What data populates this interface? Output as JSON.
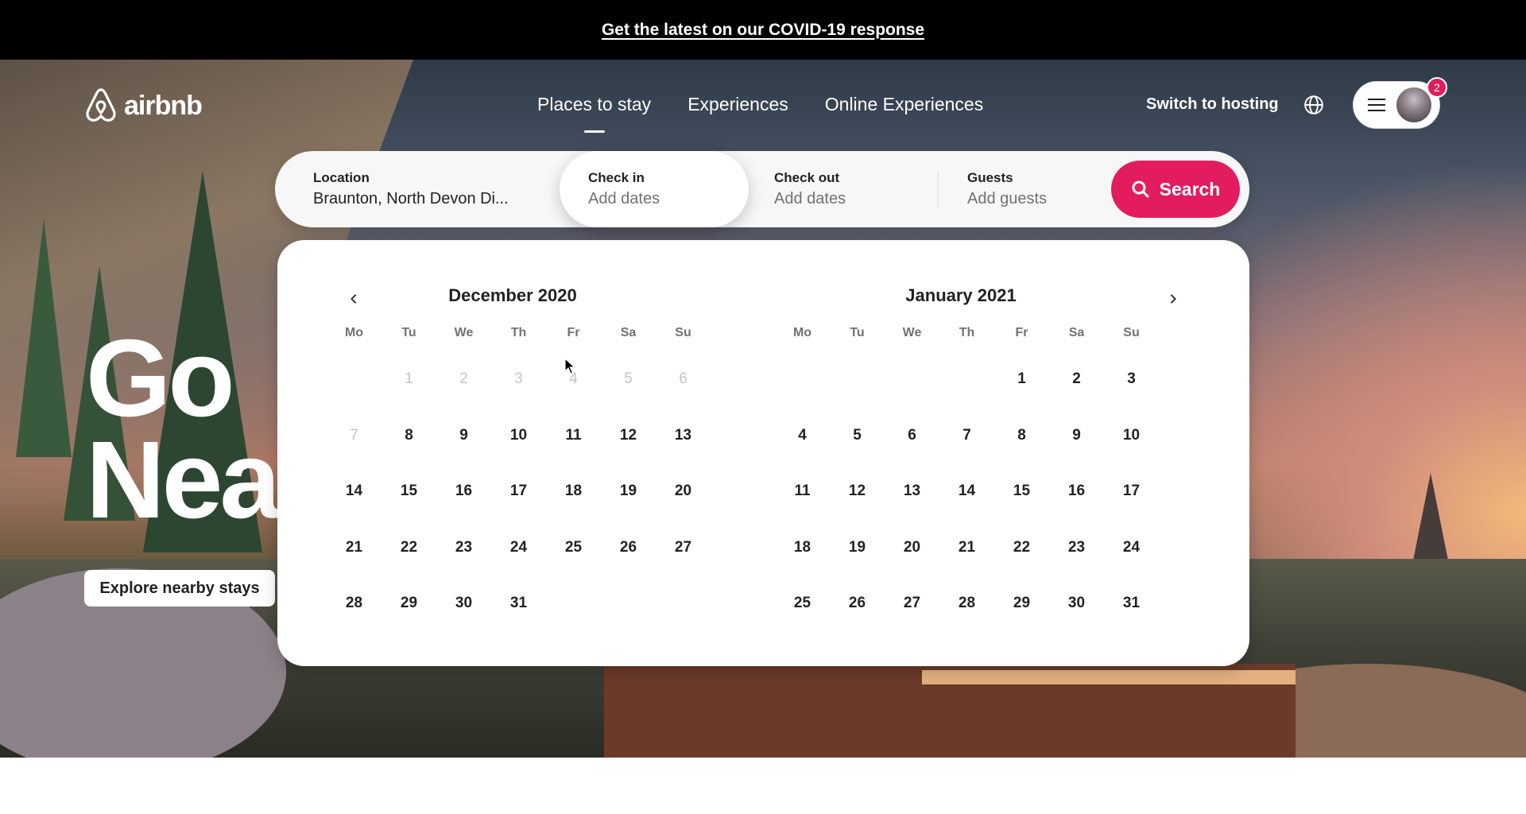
{
  "covid_banner": {
    "link_text": "Get the latest on our COVID-19 response"
  },
  "header": {
    "brand": "airbnb",
    "nav": [
      {
        "label": "Places to stay",
        "active": true
      },
      {
        "label": "Experiences",
        "active": false
      },
      {
        "label": "Online Experiences",
        "active": false
      }
    ],
    "switch_hosting": "Switch to hosting",
    "notification_count": "2"
  },
  "search": {
    "location_label": "Location",
    "location_value": "Braunton, North Devon Di...",
    "checkin_label": "Check in",
    "checkin_placeholder": "Add dates",
    "checkout_label": "Check out",
    "checkout_placeholder": "Add dates",
    "guests_label": "Guests",
    "guests_placeholder": "Add guests",
    "button_label": "Search"
  },
  "hero": {
    "title_line1": "Go",
    "title_line2": "Nea",
    "explore_label": "Explore nearby stays"
  },
  "calendar": {
    "weekdays": [
      "Mo",
      "Tu",
      "We",
      "Th",
      "Fr",
      "Sa",
      "Su"
    ],
    "months": [
      {
        "title": "December 2020",
        "offset": 1,
        "days": 31,
        "disabled_through": 7
      },
      {
        "title": "January 2021",
        "offset": 4,
        "days": 31,
        "disabled_through": 0
      }
    ]
  },
  "colors": {
    "accent": "#e31c5f",
    "banner_bg": "#000000"
  }
}
